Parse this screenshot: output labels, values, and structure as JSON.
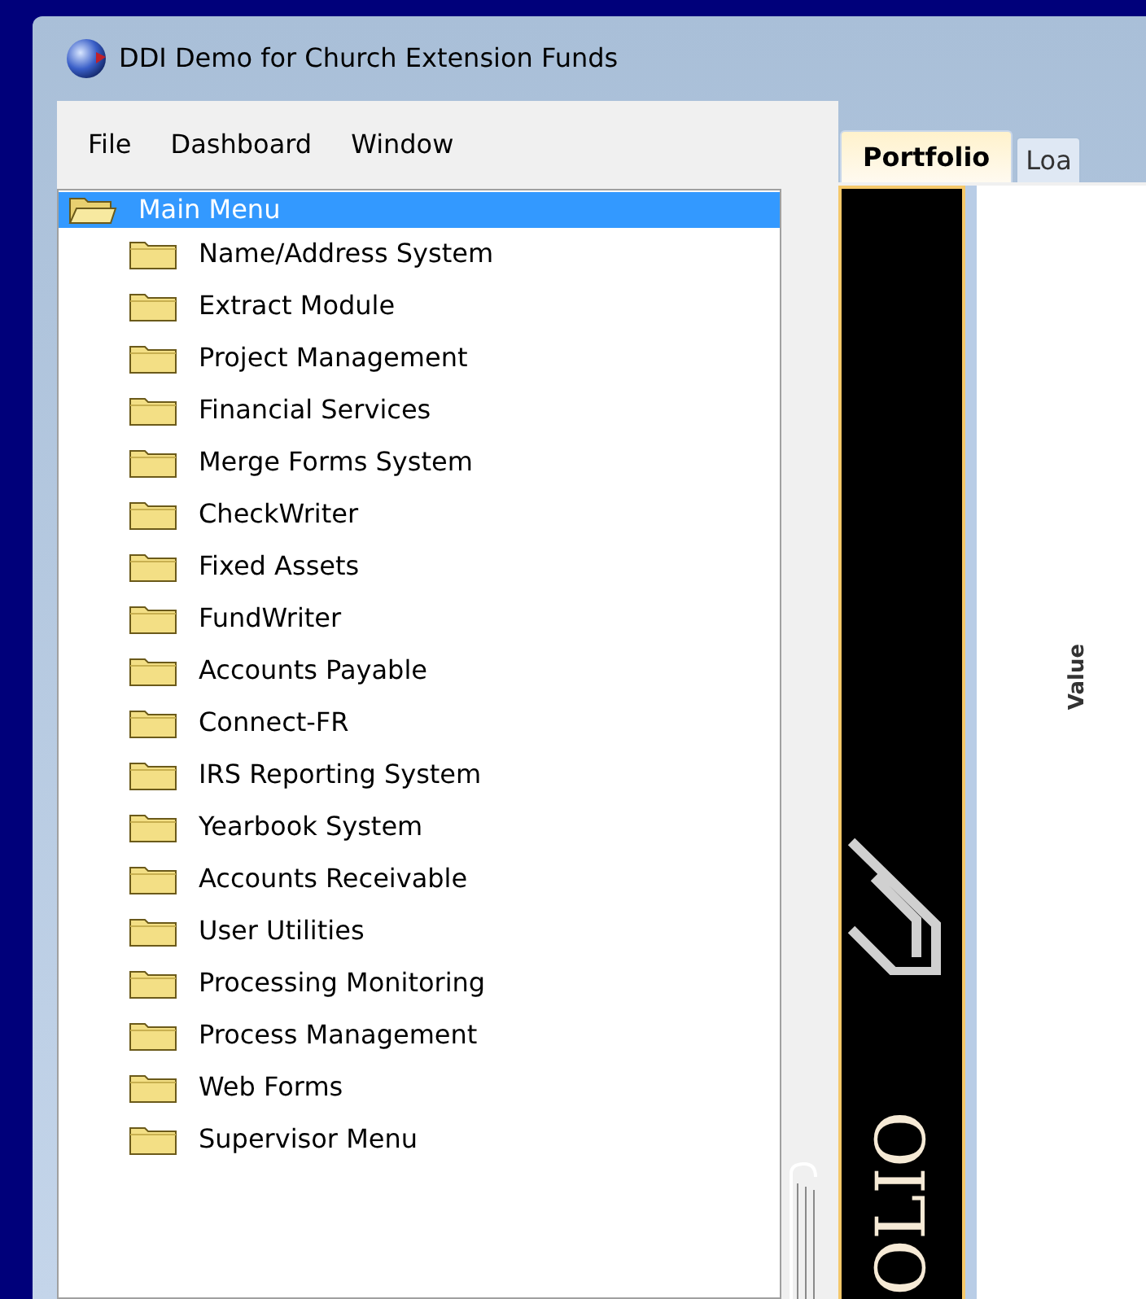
{
  "window": {
    "title": "DDI Demo for Church Extension Funds"
  },
  "menu": [
    "File",
    "Dashboard",
    "Window"
  ],
  "tree": {
    "label": "Main Menu",
    "selected": true,
    "expanded": true,
    "children": [
      {
        "label": "Name/Address System",
        "selected": false
      },
      {
        "label": "Extract Module",
        "selected": false
      },
      {
        "label": "Project Management",
        "selected": false
      },
      {
        "label": "Financial Services",
        "selected": false
      },
      {
        "label": "Merge Forms System",
        "selected": false
      },
      {
        "label": "CheckWriter",
        "selected": false
      },
      {
        "label": "Fixed Assets",
        "selected": false
      },
      {
        "label": "FundWriter",
        "selected": false
      },
      {
        "label": "Accounts Payable",
        "selected": false
      },
      {
        "label": "Connect-FR",
        "selected": false
      },
      {
        "label": "IRS Reporting System",
        "selected": false
      },
      {
        "label": "Yearbook System",
        "selected": false
      },
      {
        "label": "Accounts Receivable",
        "selected": false
      },
      {
        "label": "User Utilities",
        "selected": false
      },
      {
        "label": "Processing Monitoring",
        "selected": false
      },
      {
        "label": "Process Management",
        "selected": false
      },
      {
        "label": "Web Forms",
        "selected": false
      },
      {
        "label": "Supervisor Menu",
        "selected": false
      }
    ]
  },
  "tabs": [
    {
      "label": "Portfolio",
      "selected": true
    },
    {
      "label": "Loa",
      "selected": false
    }
  ],
  "banner": {
    "text": "OLIO"
  },
  "chart": {
    "ylabel": "Value"
  }
}
